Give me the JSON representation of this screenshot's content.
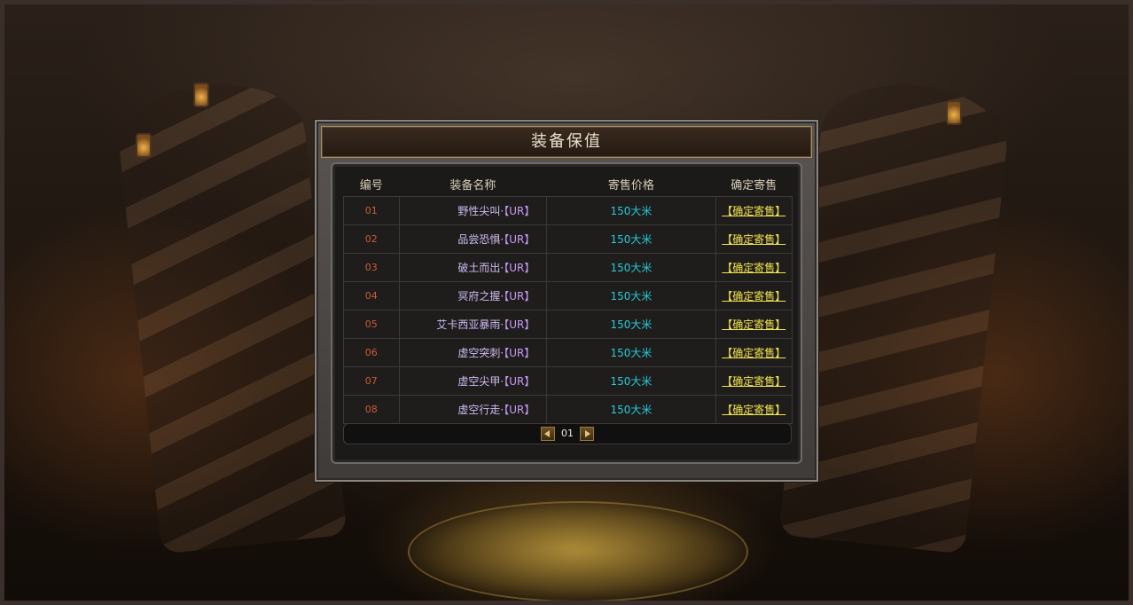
{
  "dialog": {
    "title": "装备保值",
    "columns": {
      "num": "编号",
      "name": "装备名称",
      "price": "寄售价格",
      "action": "确定寄售"
    },
    "rows": [
      {
        "num": "01",
        "name": "野性尖叫·",
        "grade": "【UR】",
        "price": "150大米",
        "action": "【确定寄售】"
      },
      {
        "num": "02",
        "name": "品尝恐惧·",
        "grade": "【UR】",
        "price": "150大米",
        "action": "【确定寄售】"
      },
      {
        "num": "03",
        "name": "破土而出·",
        "grade": "【UR】",
        "price": "150大米",
        "action": "【确定寄售】"
      },
      {
        "num": "04",
        "name": "冥府之握·",
        "grade": "【UR】",
        "price": "150大米",
        "action": "【确定寄售】"
      },
      {
        "num": "05",
        "name": "艾卡西亚暴雨·",
        "grade": "【UR】",
        "price": "150大米",
        "action": "【确定寄售】"
      },
      {
        "num": "06",
        "name": "虚空突刺·",
        "grade": "【UR】",
        "price": "150大米",
        "action": "【确定寄售】"
      },
      {
        "num": "07",
        "name": "虚空尖甲·",
        "grade": "【UR】",
        "price": "150大米",
        "action": "【确定寄售】"
      },
      {
        "num": "08",
        "name": "虚空行走·",
        "grade": "【UR】",
        "price": "150大米",
        "action": "【确定寄售】"
      }
    ],
    "pagination": {
      "current_page": "01",
      "prev_icon": "arrow-left-icon",
      "next_icon": "arrow-right-icon"
    }
  },
  "colors": {
    "num": "#d05a2c",
    "name": "#cdb9ef",
    "price": "#27c9d8",
    "action": "#f2e34a"
  }
}
